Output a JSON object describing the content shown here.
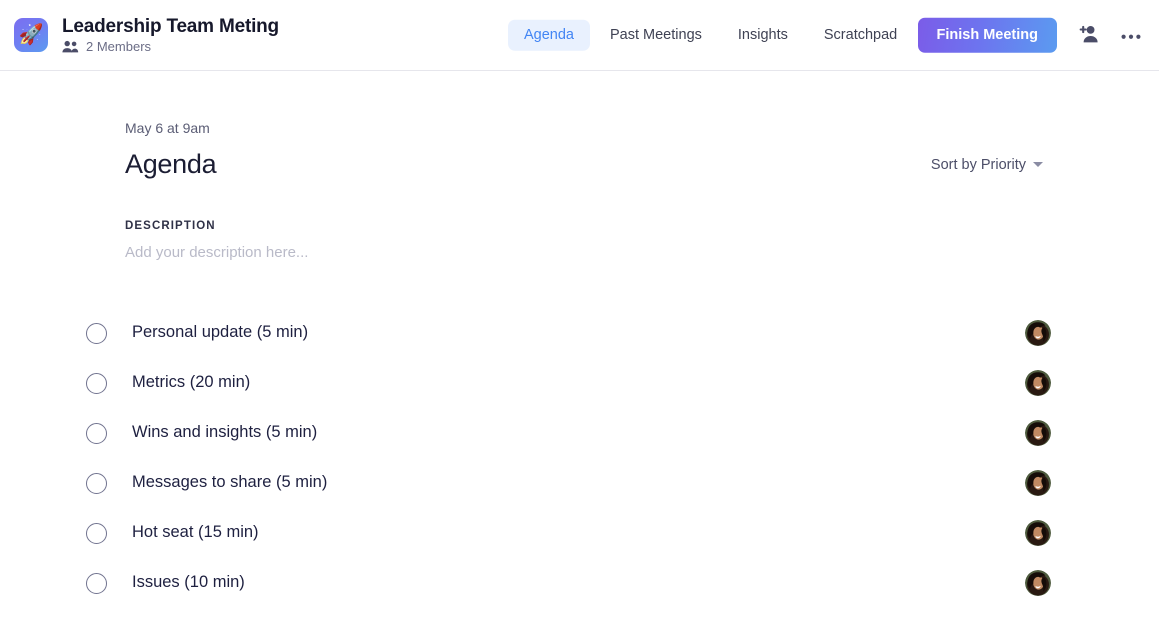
{
  "header": {
    "logo_icon": "rocket-icon",
    "meeting_title": "Leadership Team Meting",
    "members_icon": "people-icon",
    "members_text": "2 Members",
    "tabs": [
      {
        "label": "Agenda",
        "active": true
      },
      {
        "label": "Past Meetings",
        "active": false
      },
      {
        "label": "Insights",
        "active": false
      },
      {
        "label": "Scratchpad",
        "active": false
      }
    ],
    "finish_button_label": "Finish Meeting",
    "add_person_icon": "add-person-icon",
    "more_icon": "ellipsis-icon",
    "accent_blue": "#4285f4",
    "active_tab_bg": "#e9f1fe",
    "finish_gradient_start": "#7b5ce8",
    "finish_gradient_end": "#5b9bf0"
  },
  "main": {
    "date": "May 6 at 9am",
    "heading": "Agenda",
    "sort_label": "Sort by Priority",
    "sort_caret_icon": "chevron-down-icon",
    "description_label": "DESCRIPTION",
    "description_placeholder": "Add your description here...",
    "description_value": "",
    "agenda_items": [
      {
        "label": "Personal update (5 min)",
        "checked": false,
        "avatar": "user-avatar"
      },
      {
        "label": "Metrics (20 min)",
        "checked": false,
        "avatar": "user-avatar"
      },
      {
        "label": "Wins and insights (5 min)",
        "checked": false,
        "avatar": "user-avatar"
      },
      {
        "label": "Messages to share (5 min)",
        "checked": false,
        "avatar": "user-avatar"
      },
      {
        "label": "Hot seat (15 min)",
        "checked": false,
        "avatar": "user-avatar"
      },
      {
        "label": "Issues (10 min)",
        "checked": false,
        "avatar": "user-avatar"
      }
    ]
  }
}
